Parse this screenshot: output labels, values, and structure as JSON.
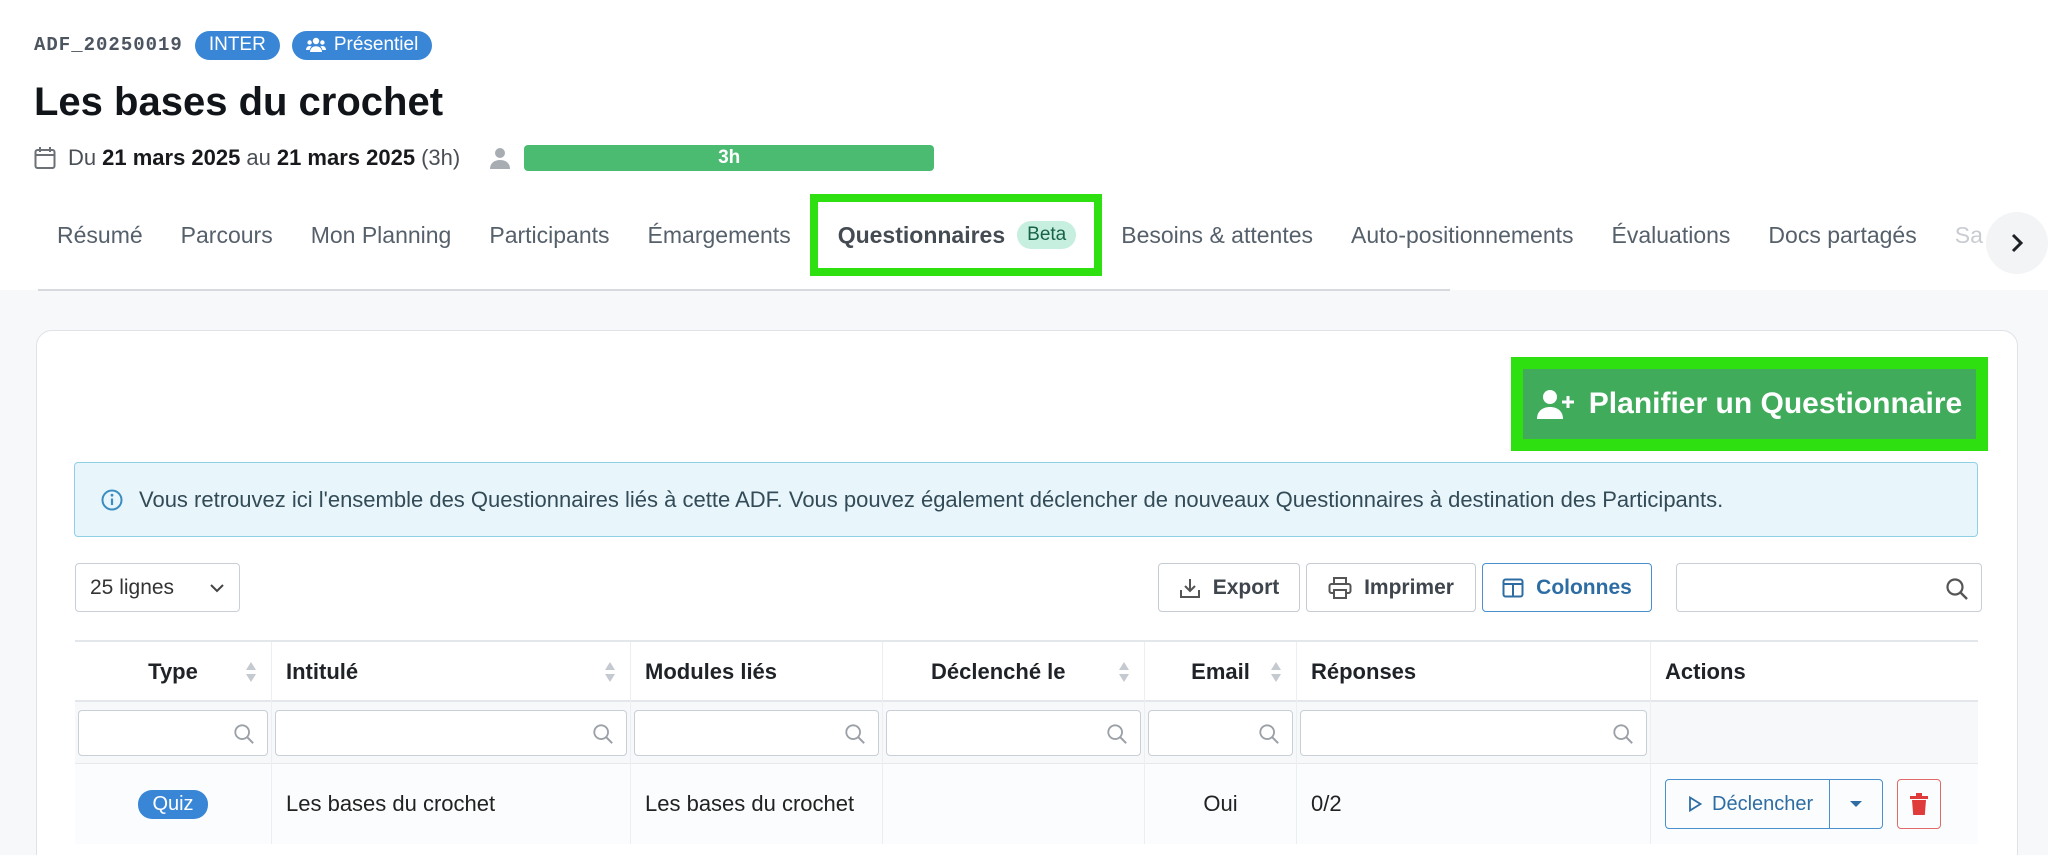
{
  "header": {
    "code": "ADF_20250019",
    "badge_inter": "INTER",
    "badge_mode": "Présentiel",
    "title": "Les bases du crochet",
    "date_prefix": "Du",
    "date_start": "21 mars 2025",
    "date_mid": "au",
    "date_end": "21 mars 2025",
    "duration": "(3h)",
    "progress_label": "3h",
    "progress_fraction": 1.0
  },
  "tabs": [
    {
      "label": "Résumé"
    },
    {
      "label": "Parcours"
    },
    {
      "label": "Mon Planning"
    },
    {
      "label": "Participants"
    },
    {
      "label": "Émargements"
    },
    {
      "label": "Questionnaires",
      "badge": "Beta",
      "active": true
    },
    {
      "label": "Besoins & attentes"
    },
    {
      "label": "Auto-positionnements"
    },
    {
      "label": "Évaluations"
    },
    {
      "label": "Docs partagés"
    },
    {
      "label": "Sa"
    }
  ],
  "actions": {
    "plan_button": "Planifier un Questionnaire"
  },
  "info": {
    "text": "Vous retrouvez ici l'ensemble des Questionnaires liés à cette ADF. Vous pouvez également déclencher de nouveaux Questionnaires à destination des Participants."
  },
  "toolbar": {
    "page_size": "25 lignes",
    "export": "Export",
    "print": "Imprimer",
    "columns": "Colonnes",
    "search_placeholder": ""
  },
  "table": {
    "columns": [
      "Type",
      "Intitulé",
      "Modules liés",
      "Déclenché le",
      "Email",
      "Réponses",
      "Actions"
    ],
    "rows": [
      {
        "type": "Quiz",
        "intitule": "Les bases du crochet",
        "modules": "Les bases du crochet",
        "declenche": "",
        "email": "Oui",
        "reponses": "0/2",
        "action_label": "Déclencher"
      }
    ]
  },
  "colors": {
    "accent_blue": "#3a86d6",
    "success_green": "#41ab5c",
    "highlight": "#2ee010",
    "danger": "#e03b3b"
  }
}
